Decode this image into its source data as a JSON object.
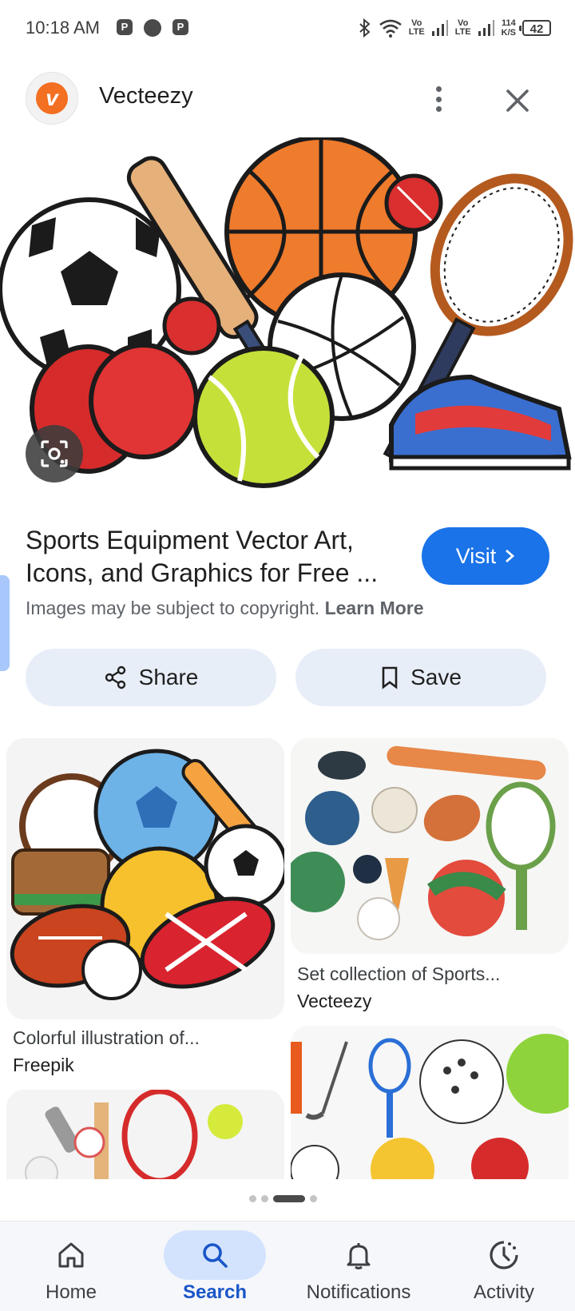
{
  "status_bar": {
    "time": "10:18 AM",
    "notif_icons": [
      "P",
      "P"
    ],
    "volte_1": "Vo\nLTE",
    "volte_2": "Vo\nLTE",
    "net_speed": "114\nK/S",
    "battery": "42"
  },
  "header": {
    "source_name": "Vecteezy",
    "source_logo_letter": "v"
  },
  "result": {
    "title": "Sports Equipment Vector Art, Icons, and Graphics for Free ...",
    "visit_label": "Visit",
    "copyright_text": "Images may be subject to copyright.",
    "learn_more": "Learn More",
    "share_label": "Share",
    "save_label": "Save"
  },
  "related": [
    {
      "caption": "Colorful illustration of...",
      "source": "Freepik"
    },
    {
      "caption": "Set collection of Sports...",
      "source": "Vecteezy"
    }
  ],
  "pagination": {
    "count": 4,
    "active": 2
  },
  "nav": {
    "items": [
      {
        "label": "Home",
        "icon": "home-icon"
      },
      {
        "label": "Search",
        "icon": "search-icon"
      },
      {
        "label": "Notifications",
        "icon": "bell-icon"
      },
      {
        "label": "Activity",
        "icon": "activity-icon"
      }
    ],
    "active_index": 1
  },
  "colors": {
    "accent": "#1a73e8",
    "pill_bg": "#e8eef8",
    "nav_active_bg": "#d3e3fd",
    "vecteezy_orange": "#f36f21"
  }
}
